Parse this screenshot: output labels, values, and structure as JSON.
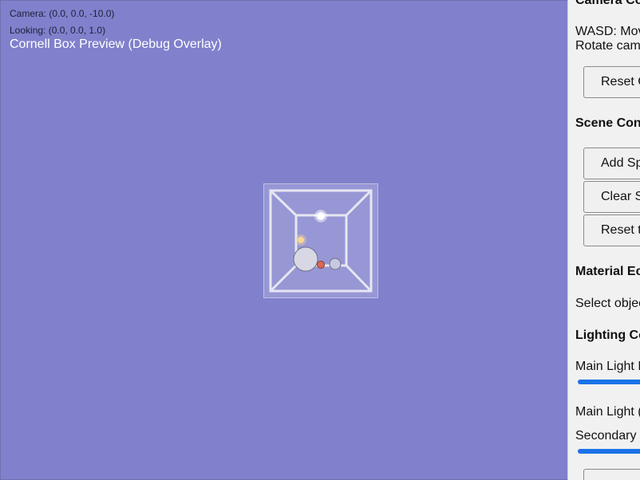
{
  "hud": {
    "camera": "Camera: (0.0, 0.0, -10.0)",
    "looking": "Looking: (0.0, 0.0, 1.0)",
    "title": "Cornell Box Preview (Debug Overlay)"
  },
  "panel": {
    "camera_heading": "Camera Co",
    "camera_help_1": "WASD: Mov",
    "camera_help_2": "Rotate cam",
    "reset_camera_label": "Reset C",
    "scene_heading": "Scene Con",
    "add_label": "Add Sp",
    "clear_label": "Clear S",
    "reset_scene_label": "Reset t",
    "material_heading": "Material Ec",
    "material_hint": "Select objec",
    "lighting_heading": "Lighting Co",
    "main_light_1": "Main Light I",
    "main_light_2": "Main Light (",
    "secondary_light": "Secondary",
    "slider_main_fill": 1.0,
    "slider_secondary_fill": 1.0
  },
  "colors": {
    "viewport_bg": "#8080cc",
    "slider_accent": "#1a73e8"
  }
}
